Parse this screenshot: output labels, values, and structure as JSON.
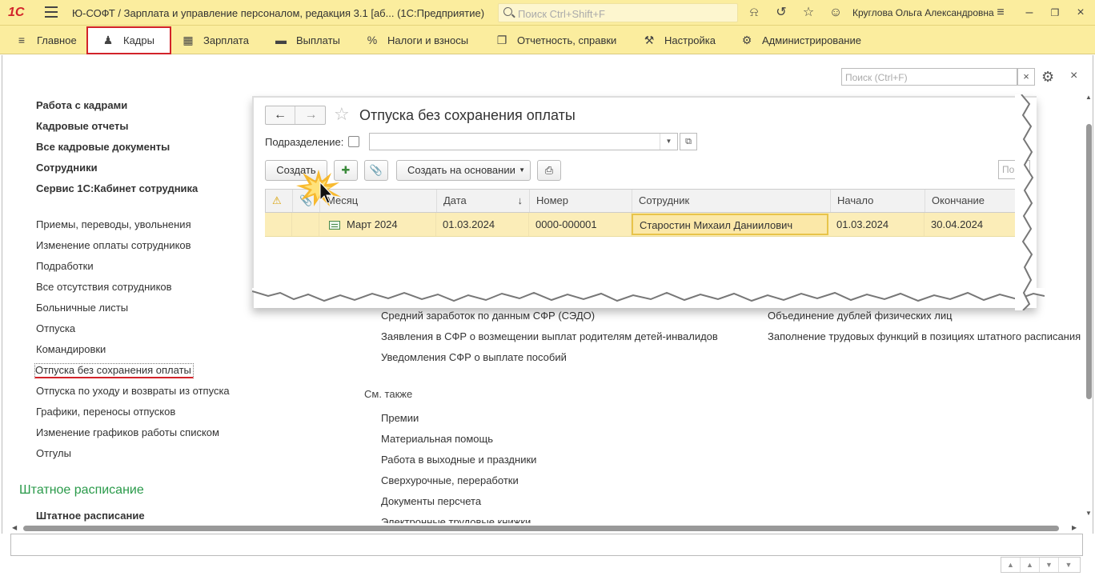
{
  "titlebar": {
    "logo": "1С",
    "title": "Ю-СОФТ / Зарплата и управление персоналом, редакция 3.1 [аб...   (1С:Предприятие)",
    "search_placeholder": "Поиск Ctrl+Shift+F",
    "user": "Круглова Ольга Александровна"
  },
  "sections": [
    {
      "label": "Главное",
      "icon": "menu-icon"
    },
    {
      "label": "Кадры",
      "icon": "people-icon"
    },
    {
      "label": "Зарплата",
      "icon": "calculator-icon"
    },
    {
      "label": "Выплаты",
      "icon": "wallet-icon"
    },
    {
      "label": "Налоги и взносы",
      "icon": "percent-icon"
    },
    {
      "label": "Отчетность, справки",
      "icon": "documents-icon"
    },
    {
      "label": "Настройка",
      "icon": "wrench-icon"
    },
    {
      "label": "Администрирование",
      "icon": "gear-icon"
    }
  ],
  "main": {
    "search_placeholder": "Поиск (Ctrl+F)",
    "clear": "×",
    "close": "×"
  },
  "nav": {
    "bold_items": [
      "Работа с кадрами",
      "Кадровые отчеты",
      "Все кадровые документы",
      "Сотрудники",
      "Сервис 1С:Кабинет сотрудника"
    ],
    "items": [
      "Приемы, переводы, увольнения",
      "Изменение оплаты сотрудников",
      "Подработки",
      "Все отсутствия сотрудников",
      "Больничные листы",
      "Отпуска",
      "Командировки",
      "Отпуска без сохранения оплаты",
      "Отпуска по уходу и возвраты из отпуска",
      "Графики, переносы отпусков",
      "Изменение графиков работы списком",
      "Отгулы"
    ],
    "group_heading": "Штатное расписание",
    "group_item": "Штатное расписание"
  },
  "right_links": {
    "col1": [
      "Средний заработок по данным СФР (СЭДО)",
      "Заявления в СФР о возмещении выплат родителям детей-инвалидов",
      "Уведомления СФР о выплате пособий"
    ],
    "col2": [
      "Объединение дублей физических лиц",
      "Заполнение трудовых функций в позициях штатного расписания"
    ],
    "see_also_label": "См. также",
    "see_also": [
      "Премии",
      "Материальная помощь",
      "Работа в выходные и праздники",
      "Сверхурочные, переработки",
      "Документы персчета",
      "Электронные трудовые книжки"
    ]
  },
  "form": {
    "title": "Отпуска без сохранения оплаты",
    "back": "←",
    "forward": "→",
    "star": "☆",
    "subdivision_label": "Подразделение:",
    "subdivision_value": "",
    "create_label": "Создать",
    "create_based_label": "Создать на основании",
    "search_placeholder": "Пои",
    "columns": [
      "",
      "",
      "Месяц",
      "Дата",
      "Номер",
      "Сотрудник",
      "Начало",
      "Окончание"
    ],
    "rows": [
      {
        "month": "Март 2024",
        "date": "01.03.2024",
        "number": "0000-000001",
        "employee": "Старостин Михаил Даниилович",
        "start": "01.03.2024",
        "end": "30.04.2024"
      }
    ]
  },
  "colors": {
    "header_bg": "#fbed9e",
    "accent_red": "#d2232a",
    "group_green": "#2a9a4a",
    "selected_row": "#fbedb8"
  }
}
